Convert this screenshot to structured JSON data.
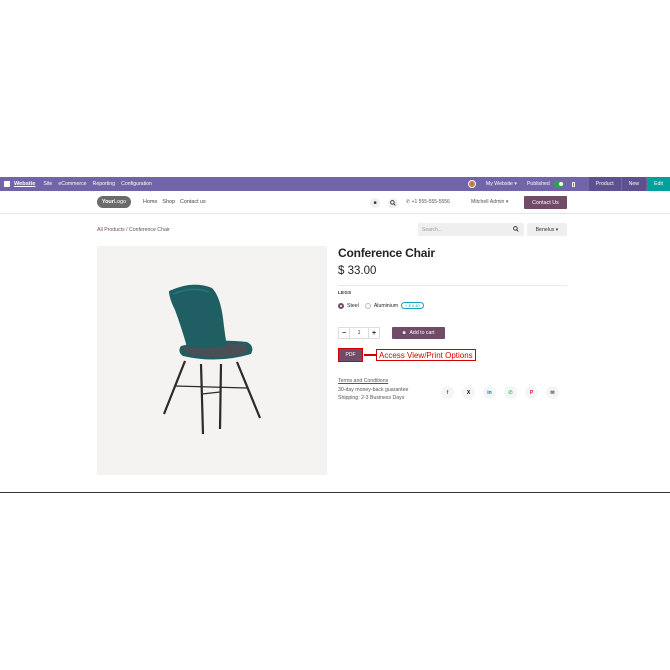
{
  "adminbar": {
    "brand": "Website",
    "menu": [
      "Site",
      "eCommerce",
      "Reporting",
      "Configuration"
    ],
    "my_website": "My Website ▾",
    "published": "Published",
    "product": "Product",
    "new": "New",
    "edit": "Edit"
  },
  "header": {
    "logo_bold": "Your",
    "logo_light": "Logo",
    "nav": [
      "Home",
      "Shop",
      "Contact us"
    ],
    "phone": "+1 555-555-5556",
    "user": "Mitchell Admin ▾",
    "contact_button": "Contact Us"
  },
  "breadcrumb": {
    "parent": "All Products",
    "separator": "/",
    "current": "Conference Chair"
  },
  "search": {
    "placeholder": "Search...",
    "pricelist": "Benelux ▾"
  },
  "product": {
    "title": "Conference Chair",
    "price": "$ 33.00",
    "attribute_label": "LEGS",
    "options": [
      {
        "label": "Steel",
        "checked": true
      },
      {
        "label": "Aluminium",
        "checked": false,
        "extra": "+ $ 6.40"
      }
    ],
    "quantity": "1",
    "add_to_cart": "Add to cart",
    "pdf_button": "PDF",
    "callout": "Access View/Print Options",
    "terms_link": "Terms and Conditions",
    "guarantee": "30-day money-back guarantee",
    "shipping": "Shipping: 2-3 Business Days"
  },
  "share": [
    {
      "icon": "facebook-icon",
      "glyph": "f",
      "color": "#3b5998"
    },
    {
      "icon": "x-icon",
      "glyph": "X",
      "color": "#000000"
    },
    {
      "icon": "linkedin-icon",
      "glyph": "in",
      "color": "#0077b5"
    },
    {
      "icon": "whatsapp-icon",
      "glyph": "✆",
      "color": "#25d366"
    },
    {
      "icon": "pinterest-icon",
      "glyph": "P",
      "color": "#cb2027"
    },
    {
      "icon": "email-icon",
      "glyph": "✉",
      "color": "#555555"
    }
  ],
  "colors": {
    "admin_bar": "#7164a8",
    "brand_primary": "#714b67",
    "edit_button": "#00a09d",
    "callout_red": "#d00000",
    "chair_shell": "#1f5f63"
  }
}
